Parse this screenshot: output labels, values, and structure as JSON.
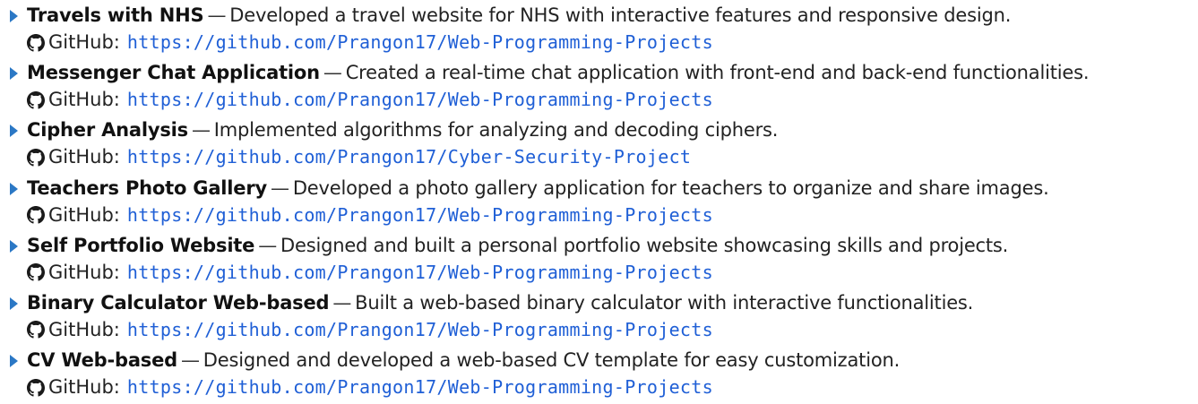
{
  "colors": {
    "bullet": "#2b78c5",
    "link": "#1f5fd6",
    "text": "#1a1a1a"
  },
  "github_label": "GitHub:",
  "separator": "—",
  "projects": [
    {
      "title": "Travels with NHS",
      "description": "Developed a travel website for NHS with interactive features and responsive design.",
      "url": "https://github.com/Prangon17/Web-Programming-Projects"
    },
    {
      "title": "Messenger Chat Application",
      "description": "Created a real-time chat application with front-end and back-end functionalities.",
      "url": "https://github.com/Prangon17/Web-Programming-Projects"
    },
    {
      "title": "Cipher Analysis",
      "description": "Implemented algorithms for analyzing and decoding ciphers.",
      "url": "https://github.com/Prangon17/Cyber-Security-Project"
    },
    {
      "title": "Teachers Photo Gallery",
      "description": "Developed a photo gallery application for teachers to organize and share images.",
      "url": "https://github.com/Prangon17/Web-Programming-Projects"
    },
    {
      "title": "Self Portfolio Website",
      "description": "Designed and built a personal portfolio website showcasing skills and projects.",
      "url": "https://github.com/Prangon17/Web-Programming-Projects"
    },
    {
      "title": "Binary Calculator Web-based",
      "description": "Built a web-based binary calculator with interactive functionalities.",
      "url": "https://github.com/Prangon17/Web-Programming-Projects"
    },
    {
      "title": "CV Web-based",
      "description": "Designed and developed a web-based CV template for easy customization.",
      "url": "https://github.com/Prangon17/Web-Programming-Projects"
    }
  ]
}
